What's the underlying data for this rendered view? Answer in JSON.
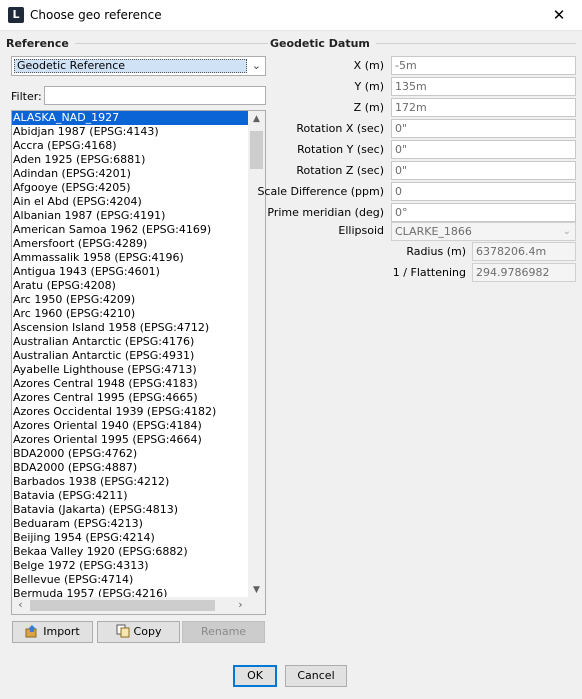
{
  "window": {
    "title": "Choose geo reference",
    "icon_letter": "L"
  },
  "reference": {
    "section_title": "Reference",
    "type_selected": "Geodetic Reference",
    "filter_label": "Filter:",
    "filter_value": "",
    "items": [
      "ALASKA_NAD_1927",
      "Abidjan 1987 (EPSG:4143)",
      "Accra (EPSG:4168)",
      "Aden 1925 (EPSG:6881)",
      "Adindan (EPSG:4201)",
      "Afgooye (EPSG:4205)",
      "Ain el Abd (EPSG:4204)",
      "Albanian 1987 (EPSG:4191)",
      "American Samoa 1962 (EPSG:4169)",
      "Amersfoort (EPSG:4289)",
      "Ammassalik 1958 (EPSG:4196)",
      "Antigua 1943 (EPSG:4601)",
      "Aratu (EPSG:4208)",
      "Arc 1950 (EPSG:4209)",
      "Arc 1960 (EPSG:4210)",
      "Ascension Island 1958 (EPSG:4712)",
      "Australian Antarctic (EPSG:4176)",
      "Australian Antarctic (EPSG:4931)",
      "Ayabelle Lighthouse (EPSG:4713)",
      "Azores Central 1948 (EPSG:4183)",
      "Azores Central 1995 (EPSG:4665)",
      "Azores Occidental 1939 (EPSG:4182)",
      "Azores Oriental 1940 (EPSG:4184)",
      "Azores Oriental 1995 (EPSG:4664)",
      "BDA2000 (EPSG:4762)",
      "BDA2000 (EPSG:4887)",
      "Barbados 1938 (EPSG:4212)",
      "Batavia (EPSG:4211)",
      "Batavia (Jakarta) (EPSG:4813)",
      "Beduaram (EPSG:4213)",
      "Beijing 1954 (EPSG:4214)",
      "Bekaa Valley 1920 (EPSG:6882)",
      "Belge 1972 (EPSG:4313)",
      "Bellevue (EPSG:4714)",
      "Bermuda 1957 (EPSG:4216)"
    ],
    "buttons": {
      "import": "Import",
      "copy": "Copy",
      "rename": "Rename"
    }
  },
  "datum": {
    "section_title": "Geodetic Datum",
    "fields": [
      {
        "label": "X (m)",
        "value": "-5m"
      },
      {
        "label": "Y (m)",
        "value": "135m"
      },
      {
        "label": "Z (m)",
        "value": "172m"
      },
      {
        "label": "Rotation X (sec)",
        "value": "0\""
      },
      {
        "label": "Rotation Y (sec)",
        "value": "0\""
      },
      {
        "label": "Rotation Z (sec)",
        "value": "0\""
      },
      {
        "label": "Scale Difference (ppm)",
        "value": "0"
      },
      {
        "label": "Prime meridian (deg)",
        "value": "0°"
      }
    ],
    "ellipsoid_label": "Ellipsoid",
    "ellipsoid_value": "CLARKE_1866",
    "radius_label": "Radius (m)",
    "radius_value": "6378206.4m",
    "flattening_label": "1 / Flattening",
    "flattening_value": "294.9786982"
  },
  "footer": {
    "ok": "OK",
    "cancel": "Cancel"
  },
  "colors": {
    "selection": "#0a64d6",
    "default_button_border": "#0078d7"
  }
}
